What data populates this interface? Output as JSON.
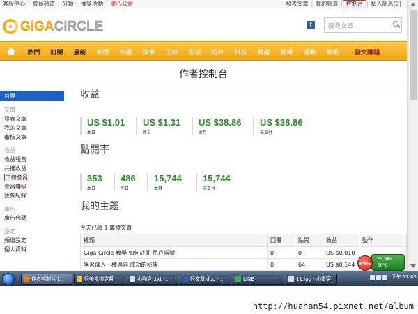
{
  "topbar": {
    "left": [
      "客服中心",
      "會員頻道",
      "分類",
      "抽獎活動",
      "愛心公益"
    ],
    "right": [
      "發表文章",
      "我的頻道",
      "控制台",
      "私人訊息(0)"
    ]
  },
  "brand": {
    "logo_part1": "GIGA",
    "logo_part2": "CIRCLE",
    "search_placeholder": "搜尋文章",
    "fb_letter": "f",
    "colors": {
      "accent": "#f2b21c",
      "nav": "#f1a510",
      "active": "#1e63c4",
      "money": "#2d8a2d"
    }
  },
  "nav": {
    "items": [
      "熱門",
      "訂閱",
      "最新",
      "新聞",
      "奇趣",
      "故事",
      "正妹",
      "生活",
      "短片",
      "科技",
      "興趣",
      "娛樂",
      "運動",
      "幫助"
    ],
    "earn": "發文賺錢"
  },
  "page": {
    "title": "作者控制台"
  },
  "sidebar": {
    "home": "首頁",
    "sec_article": "文章",
    "items_article": [
      "發表文章",
      "我的文章",
      "審核文章"
    ],
    "sec_earn": "收益",
    "items_earn": [
      "收益報告",
      "共推收益",
      "下線會員",
      "會員等級",
      "匯款紀錄"
    ],
    "sec_ads": "廣告",
    "items_ads": [
      "廣告代碼"
    ],
    "sec_settings": "設定",
    "items_settings": [
      "頻道設定",
      "個人資料"
    ]
  },
  "revenue": {
    "heading": "收益",
    "stats": [
      {
        "value": "US $1.01",
        "label": "本日"
      },
      {
        "value": "US $1.31",
        "label": "昨日"
      },
      {
        "value": "US $38.86",
        "label": "本月"
      },
      {
        "value": "US $38.86",
        "label": "未支付"
      }
    ]
  },
  "views": {
    "heading": "點閱率",
    "stats": [
      {
        "value": "353",
        "label": "本日"
      },
      {
        "value": "486",
        "label": "昨日"
      },
      {
        "value": "15,744",
        "label": "本月"
      },
      {
        "value": "15,744",
        "label": "未支付"
      }
    ]
  },
  "topics": {
    "heading": "我的主題",
    "note": "今天已順 1 篇發文費",
    "columns": [
      "標題",
      "回覆",
      "點閱",
      "收益",
      "動作"
    ],
    "rows": [
      [
        "Giga Circle 教學 如何註冊 用戶帳號",
        "0",
        "0",
        "US $0.010",
        ""
      ],
      [
        "學習偉人一樣邁向 成功的秘訣",
        "0",
        "64",
        "US $0.144",
        ""
      ]
    ]
  },
  "taskbar": {
    "tasks": [
      "作者控制台 |...",
      "好美食抱克幫",
      "小咖克 .txt -...",
      "好文章.doc -...",
      "LINE",
      "11.jpg - 小畫家"
    ],
    "time": "下午 12:05"
  },
  "widget": {
    "percent": "94%",
    "line1": "15.9KB",
    "line2": "30°C"
  },
  "footer": {
    "url": "http://huahan54.pixnet.net/album"
  }
}
